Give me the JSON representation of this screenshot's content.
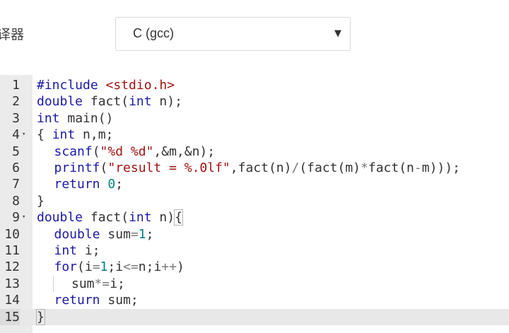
{
  "compiler": {
    "label": "译器",
    "selected": "C (gcc)",
    "arrow_icon": "caret-down-icon"
  },
  "editor": {
    "active_line": 15,
    "colors": {
      "keyword": "#1a1aa6",
      "string": "#a11313",
      "number": "#008080",
      "operator": "#7a7a7a",
      "text": "#333333",
      "gutter": "#ebebeb"
    },
    "lines": [
      {
        "number": "1",
        "fold": false,
        "indent": 0,
        "tokens": [
          {
            "t": "pp",
            "v": "#include "
          },
          {
            "t": "hdr",
            "v": "<stdio.h>"
          }
        ]
      },
      {
        "number": "2",
        "fold": false,
        "indent": 0,
        "tokens": [
          {
            "t": "kw",
            "v": "double"
          },
          {
            "t": "txt",
            "v": " fact("
          },
          {
            "t": "kw",
            "v": "int"
          },
          {
            "t": "txt",
            "v": " n);"
          }
        ]
      },
      {
        "number": "3",
        "fold": false,
        "indent": 0,
        "tokens": [
          {
            "t": "kw",
            "v": "int"
          },
          {
            "t": "txt",
            "v": " main()"
          }
        ]
      },
      {
        "number": "4",
        "fold": true,
        "indent": 0,
        "tokens": [
          {
            "t": "txt",
            "v": "{ "
          },
          {
            "t": "kw",
            "v": "int"
          },
          {
            "t": "txt",
            "v": " n,m;"
          }
        ]
      },
      {
        "number": "5",
        "fold": false,
        "indent": 1,
        "tokens": [
          {
            "t": "kw",
            "v": "scanf"
          },
          {
            "t": "txt",
            "v": "("
          },
          {
            "t": "str",
            "v": "\"%d %d\""
          },
          {
            "t": "txt",
            "v": ",&m,&n);"
          }
        ]
      },
      {
        "number": "6",
        "fold": false,
        "indent": 1,
        "tokens": [
          {
            "t": "kw",
            "v": "printf"
          },
          {
            "t": "txt",
            "v": "("
          },
          {
            "t": "str",
            "v": "\"result = %.0lf\""
          },
          {
            "t": "txt",
            "v": ",fact(n)"
          },
          {
            "t": "op",
            "v": "/"
          },
          {
            "t": "txt",
            "v": "(fact(m)"
          },
          {
            "t": "op",
            "v": "*"
          },
          {
            "t": "txt",
            "v": "fact(n"
          },
          {
            "t": "op",
            "v": "-"
          },
          {
            "t": "txt",
            "v": "m)));"
          }
        ]
      },
      {
        "number": "7",
        "fold": false,
        "indent": 1,
        "tokens": [
          {
            "t": "kw",
            "v": "return"
          },
          {
            "t": "txt",
            "v": " "
          },
          {
            "t": "num",
            "v": "0"
          },
          {
            "t": "txt",
            "v": ";"
          }
        ]
      },
      {
        "number": "8",
        "fold": false,
        "indent": 0,
        "tokens": [
          {
            "t": "txt",
            "v": "}"
          }
        ]
      },
      {
        "number": "9",
        "fold": true,
        "indent": 0,
        "tokens": [
          {
            "t": "kw",
            "v": "double"
          },
          {
            "t": "txt",
            "v": " fact("
          },
          {
            "t": "kw",
            "v": "int"
          },
          {
            "t": "txt",
            "v": " n)"
          },
          {
            "t": "brk",
            "v": "{"
          }
        ]
      },
      {
        "number": "10",
        "fold": false,
        "indent": 1,
        "tokens": [
          {
            "t": "kw",
            "v": "double"
          },
          {
            "t": "txt",
            "v": " sum"
          },
          {
            "t": "op",
            "v": "="
          },
          {
            "t": "num",
            "v": "1"
          },
          {
            "t": "txt",
            "v": ";"
          }
        ]
      },
      {
        "number": "11",
        "fold": false,
        "indent": 1,
        "tokens": [
          {
            "t": "kw",
            "v": "int"
          },
          {
            "t": "txt",
            "v": " i;"
          }
        ]
      },
      {
        "number": "12",
        "fold": false,
        "indent": 1,
        "tokens": [
          {
            "t": "kw",
            "v": "for"
          },
          {
            "t": "txt",
            "v": "(i"
          },
          {
            "t": "op",
            "v": "="
          },
          {
            "t": "num",
            "v": "1"
          },
          {
            "t": "txt",
            "v": ";i"
          },
          {
            "t": "op",
            "v": "<="
          },
          {
            "t": "txt",
            "v": "n;i"
          },
          {
            "t": "op",
            "v": "++"
          },
          {
            "t": "txt",
            "v": ")"
          }
        ]
      },
      {
        "number": "13",
        "fold": false,
        "indent": 2,
        "guide": true,
        "tokens": [
          {
            "t": "txt",
            "v": "sum"
          },
          {
            "t": "op",
            "v": "*="
          },
          {
            "t": "txt",
            "v": "i;"
          }
        ]
      },
      {
        "number": "14",
        "fold": false,
        "indent": 1,
        "tokens": [
          {
            "t": "kw",
            "v": "return"
          },
          {
            "t": "txt",
            "v": " sum;"
          }
        ]
      },
      {
        "number": "15",
        "fold": false,
        "indent": 0,
        "tokens": [
          {
            "t": "brk",
            "v": "}"
          }
        ]
      }
    ]
  }
}
